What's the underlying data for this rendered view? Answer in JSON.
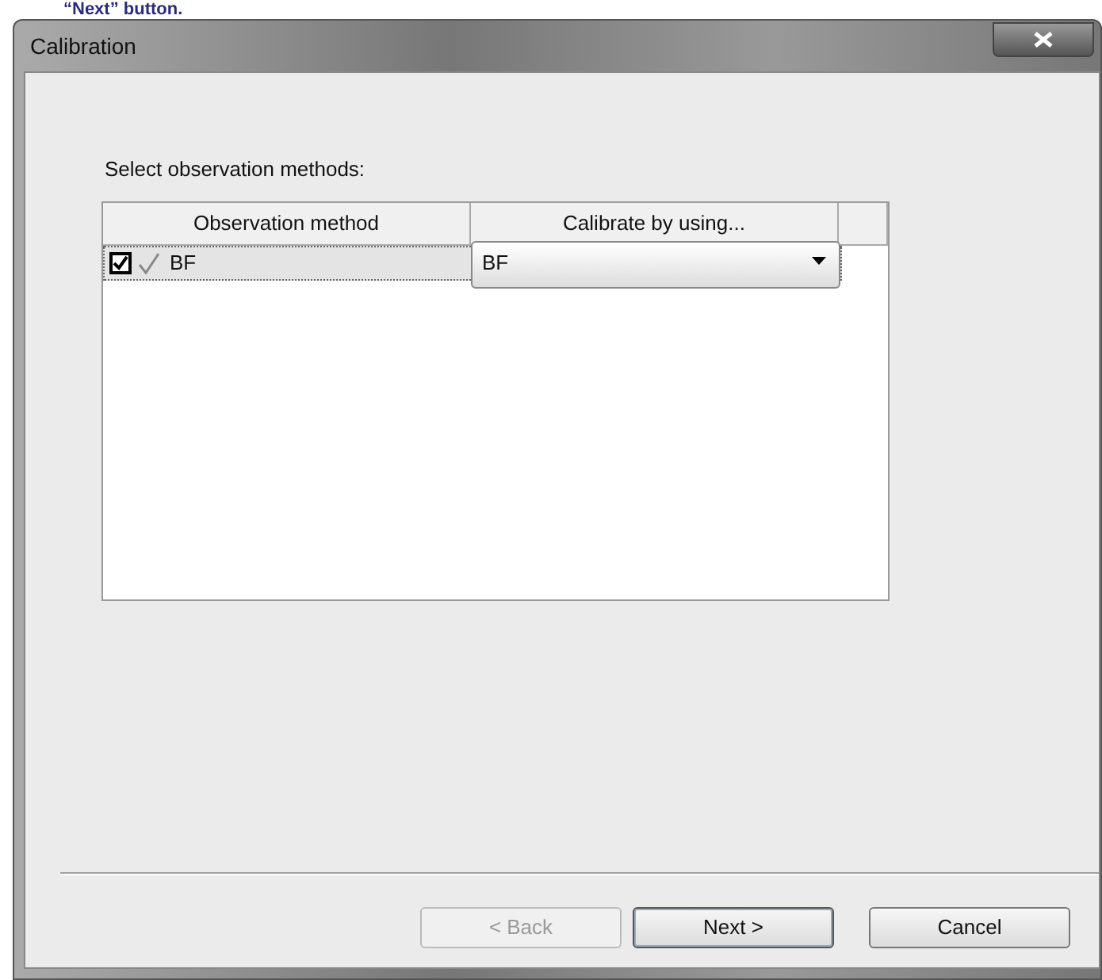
{
  "caption": "“Next” button.",
  "window": {
    "title": "Calibration"
  },
  "prompt": "Select observation methods:",
  "table": {
    "columns": [
      "Observation method",
      "Calibrate by using..."
    ],
    "rows": [
      {
        "checked": true,
        "method": "BF",
        "calibrate_by": "BF"
      }
    ]
  },
  "buttons": [
    {
      "label": "< Back",
      "disabled": true,
      "default": false
    },
    {
      "label": "Next >",
      "disabled": false,
      "default": true
    },
    {
      "label": "Cancel",
      "disabled": false,
      "default": false
    }
  ]
}
